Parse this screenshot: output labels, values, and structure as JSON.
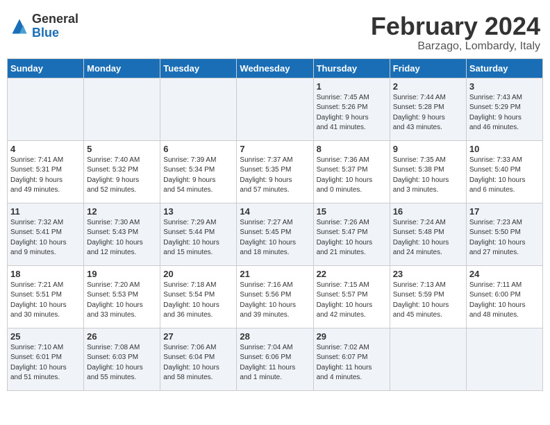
{
  "logo": {
    "text_general": "General",
    "text_blue": "Blue"
  },
  "header": {
    "month_year": "February 2024",
    "location": "Barzago, Lombardy, Italy"
  },
  "weekdays": [
    "Sunday",
    "Monday",
    "Tuesday",
    "Wednesday",
    "Thursday",
    "Friday",
    "Saturday"
  ],
  "weeks": [
    [
      {
        "day": "",
        "info": ""
      },
      {
        "day": "",
        "info": ""
      },
      {
        "day": "",
        "info": ""
      },
      {
        "day": "",
        "info": ""
      },
      {
        "day": "1",
        "info": "Sunrise: 7:45 AM\nSunset: 5:26 PM\nDaylight: 9 hours\nand 41 minutes."
      },
      {
        "day": "2",
        "info": "Sunrise: 7:44 AM\nSunset: 5:28 PM\nDaylight: 9 hours\nand 43 minutes."
      },
      {
        "day": "3",
        "info": "Sunrise: 7:43 AM\nSunset: 5:29 PM\nDaylight: 9 hours\nand 46 minutes."
      }
    ],
    [
      {
        "day": "4",
        "info": "Sunrise: 7:41 AM\nSunset: 5:31 PM\nDaylight: 9 hours\nand 49 minutes."
      },
      {
        "day": "5",
        "info": "Sunrise: 7:40 AM\nSunset: 5:32 PM\nDaylight: 9 hours\nand 52 minutes."
      },
      {
        "day": "6",
        "info": "Sunrise: 7:39 AM\nSunset: 5:34 PM\nDaylight: 9 hours\nand 54 minutes."
      },
      {
        "day": "7",
        "info": "Sunrise: 7:37 AM\nSunset: 5:35 PM\nDaylight: 9 hours\nand 57 minutes."
      },
      {
        "day": "8",
        "info": "Sunrise: 7:36 AM\nSunset: 5:37 PM\nDaylight: 10 hours\nand 0 minutes."
      },
      {
        "day": "9",
        "info": "Sunrise: 7:35 AM\nSunset: 5:38 PM\nDaylight: 10 hours\nand 3 minutes."
      },
      {
        "day": "10",
        "info": "Sunrise: 7:33 AM\nSunset: 5:40 PM\nDaylight: 10 hours\nand 6 minutes."
      }
    ],
    [
      {
        "day": "11",
        "info": "Sunrise: 7:32 AM\nSunset: 5:41 PM\nDaylight: 10 hours\nand 9 minutes."
      },
      {
        "day": "12",
        "info": "Sunrise: 7:30 AM\nSunset: 5:43 PM\nDaylight: 10 hours\nand 12 minutes."
      },
      {
        "day": "13",
        "info": "Sunrise: 7:29 AM\nSunset: 5:44 PM\nDaylight: 10 hours\nand 15 minutes."
      },
      {
        "day": "14",
        "info": "Sunrise: 7:27 AM\nSunset: 5:45 PM\nDaylight: 10 hours\nand 18 minutes."
      },
      {
        "day": "15",
        "info": "Sunrise: 7:26 AM\nSunset: 5:47 PM\nDaylight: 10 hours\nand 21 minutes."
      },
      {
        "day": "16",
        "info": "Sunrise: 7:24 AM\nSunset: 5:48 PM\nDaylight: 10 hours\nand 24 minutes."
      },
      {
        "day": "17",
        "info": "Sunrise: 7:23 AM\nSunset: 5:50 PM\nDaylight: 10 hours\nand 27 minutes."
      }
    ],
    [
      {
        "day": "18",
        "info": "Sunrise: 7:21 AM\nSunset: 5:51 PM\nDaylight: 10 hours\nand 30 minutes."
      },
      {
        "day": "19",
        "info": "Sunrise: 7:20 AM\nSunset: 5:53 PM\nDaylight: 10 hours\nand 33 minutes."
      },
      {
        "day": "20",
        "info": "Sunrise: 7:18 AM\nSunset: 5:54 PM\nDaylight: 10 hours\nand 36 minutes."
      },
      {
        "day": "21",
        "info": "Sunrise: 7:16 AM\nSunset: 5:56 PM\nDaylight: 10 hours\nand 39 minutes."
      },
      {
        "day": "22",
        "info": "Sunrise: 7:15 AM\nSunset: 5:57 PM\nDaylight: 10 hours\nand 42 minutes."
      },
      {
        "day": "23",
        "info": "Sunrise: 7:13 AM\nSunset: 5:59 PM\nDaylight: 10 hours\nand 45 minutes."
      },
      {
        "day": "24",
        "info": "Sunrise: 7:11 AM\nSunset: 6:00 PM\nDaylight: 10 hours\nand 48 minutes."
      }
    ],
    [
      {
        "day": "25",
        "info": "Sunrise: 7:10 AM\nSunset: 6:01 PM\nDaylight: 10 hours\nand 51 minutes."
      },
      {
        "day": "26",
        "info": "Sunrise: 7:08 AM\nSunset: 6:03 PM\nDaylight: 10 hours\nand 55 minutes."
      },
      {
        "day": "27",
        "info": "Sunrise: 7:06 AM\nSunset: 6:04 PM\nDaylight: 10 hours\nand 58 minutes."
      },
      {
        "day": "28",
        "info": "Sunrise: 7:04 AM\nSunset: 6:06 PM\nDaylight: 11 hours\nand 1 minute."
      },
      {
        "day": "29",
        "info": "Sunrise: 7:02 AM\nSunset: 6:07 PM\nDaylight: 11 hours\nand 4 minutes."
      },
      {
        "day": "",
        "info": ""
      },
      {
        "day": "",
        "info": ""
      }
    ]
  ]
}
